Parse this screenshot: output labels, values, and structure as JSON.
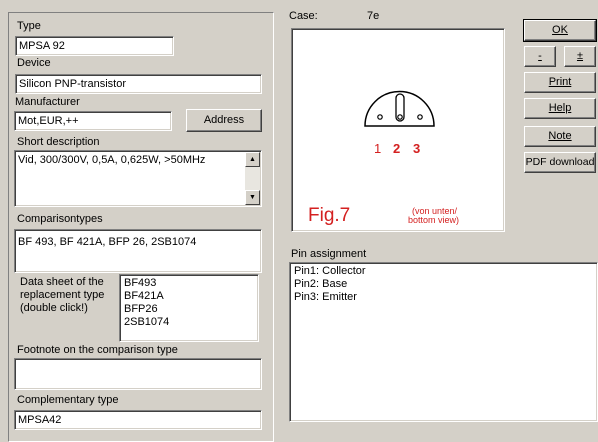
{
  "left": {
    "type_label": "Type",
    "type_value": "MPSA 92",
    "device_label": "Device",
    "device_value": "Silicon PNP-transistor",
    "manufacturer_label": "Manufacturer",
    "manufacturer_value": "Mot,EUR,++",
    "address_button": "Address",
    "short_desc_label": "Short description",
    "short_desc_value": "Vid, 300/300V, 0,5A, 0,625W, >50MHz",
    "comparison_label": "Comparisontypes",
    "comparison_value": "BF 493, BF 421A, BFP 26, 2SB1074",
    "datasheet_label_1": "Data sheet of the",
    "datasheet_label_2": "replacement type",
    "datasheet_label_3": "(double click!)",
    "datasheet_items": [
      "BF493",
      "BF421A",
      "BFP26",
      "2SB1074"
    ],
    "footnote_label": "Footnote on the comparison type",
    "footnote_value": "",
    "complementary_label": "Complementary type",
    "complementary_value": "MPSA42"
  },
  "case": {
    "label": "Case:",
    "value": "7e",
    "pins": [
      "1",
      "2",
      "3"
    ],
    "fig_label": "Fig.7",
    "view_note_1": "(von unten/",
    "view_note_2": "bottom view)"
  },
  "pin_assignment": {
    "label": "Pin assignment",
    "lines": [
      "Pin1: Collector",
      "Pin2: Base",
      "Pin3: Emitter"
    ]
  },
  "buttons": {
    "ok": "OK",
    "minus": "-",
    "plusminus": "±",
    "print": "Print",
    "help": "Help",
    "note": "Note",
    "pdf": "PDF download"
  },
  "colors": {
    "face": "#d4d0c8",
    "accent_red": "#d42020"
  }
}
